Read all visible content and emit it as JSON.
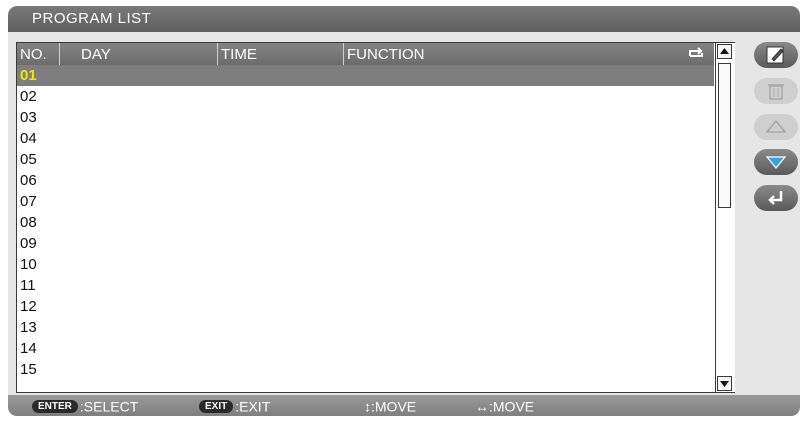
{
  "window": {
    "title": "PROGRAM LIST"
  },
  "table": {
    "columns": [
      "NO.",
      "DAY",
      "TIME",
      "FUNCTION"
    ],
    "repeat_icon": "repeat-icon",
    "rows": [
      "01",
      "02",
      "03",
      "04",
      "05",
      "06",
      "07",
      "08",
      "09",
      "10",
      "11",
      "12",
      "13",
      "14",
      "15"
    ],
    "selected_index": 0
  },
  "side_buttons": [
    {
      "icon": "edit-icon",
      "state": "active"
    },
    {
      "icon": "trash-icon",
      "state": "disabled"
    },
    {
      "icon": "triangle-up-icon",
      "state": "disabled"
    },
    {
      "icon": "triangle-down-icon",
      "state": "active"
    },
    {
      "icon": "return-icon",
      "state": "active"
    }
  ],
  "footer": {
    "enter_key": "ENTER",
    "enter_label": ":SELECT",
    "exit_key": "EXIT",
    "exit_label": ":EXIT",
    "updown_label": "↕:MOVE",
    "leftright_label": "↔:MOVE"
  },
  "colors": {
    "selected_row_bg": "#7e7e7e",
    "selected_text": "#f2e600",
    "side_button_down": "#3aa0e0"
  }
}
